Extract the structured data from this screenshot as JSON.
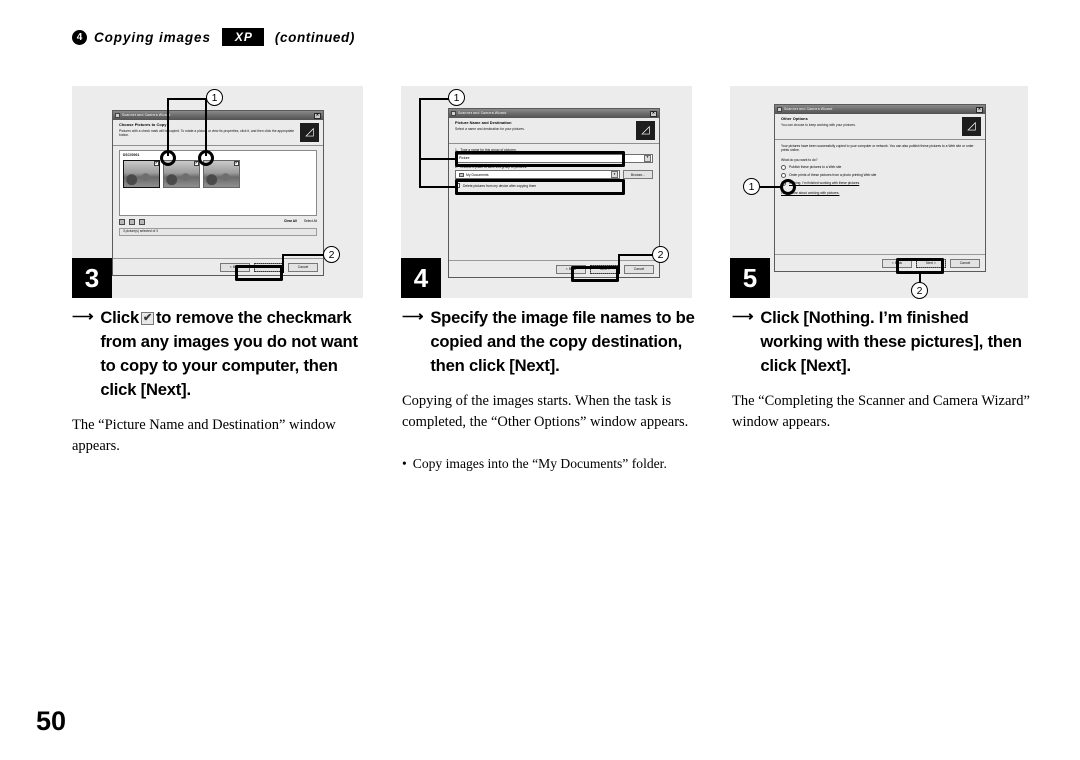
{
  "header": {
    "bullet": "4",
    "title": "Copying images",
    "badge": "XP",
    "continued": "(continued)"
  },
  "page_number": "50",
  "panels": [
    {
      "step": "3",
      "dialog": {
        "titlebar": "Scanner and Camera Wizard",
        "close_label": "✕",
        "heading": "Choose Pictures to Copy",
        "subheading": "Pictures with a check mark will be copied. To rotate a picture or view its properties, click it, and then click the appropriate button.",
        "folder_label": "DSC00001",
        "thumbs": [
          {
            "checked": "✔",
            "selected": true
          },
          {
            "checked": "✔",
            "selected": false
          },
          {
            "checked": "✔",
            "selected": false
          }
        ],
        "toolbar_icons": [
          "rotate-left-icon",
          "rotate-right-icon",
          "properties-icon"
        ],
        "counts": [
          {
            "label": "Clear All",
            "value": ""
          },
          {
            "label": "Select All",
            "value": ""
          }
        ],
        "status": "3 picture(s) selected of 3",
        "buttons": [
          {
            "label": "< Back",
            "highlighted": false
          },
          {
            "label": "Next >",
            "highlighted": true
          },
          {
            "label": "Cancel",
            "highlighted": false
          }
        ]
      },
      "callouts": [
        "1",
        "2"
      ]
    },
    {
      "step": "4",
      "dialog": {
        "titlebar": "Scanner and Camera Wizard",
        "close_label": "✕",
        "heading": "Picture Name and Destination",
        "subheading": "Select a name and destination for your pictures.",
        "fields": [
          {
            "num": "1.",
            "label": "Type a name for this group of pictures:",
            "value": "Picture",
            "arrow": "▼"
          },
          {
            "num": "2.",
            "label": "Choose a place to save this group of pictures:",
            "value": "My Documents",
            "arrow": "▼",
            "browse_label": "Browse..."
          }
        ],
        "checkbox_label": "Delete pictures from my device after copying them",
        "buttons": [
          {
            "label": "< Back",
            "highlighted": false
          },
          {
            "label": "Next >",
            "highlighted": true
          },
          {
            "label": "Cancel",
            "highlighted": false
          }
        ]
      },
      "callouts": [
        "1",
        "2"
      ]
    },
    {
      "step": "5",
      "dialog": {
        "titlebar": "Scanner and Camera Wizard",
        "close_label": "✕",
        "heading": "Other Options",
        "subheading": "You can choose to keep working with your pictures.",
        "paragraph": "Your pictures have been successfully copied to your computer or network. You can also publish these pictures to a Web site or order prints online.",
        "question": "What do you want to do?",
        "options": [
          {
            "label": "Publish these pictures to a Web site",
            "selected": false
          },
          {
            "label": "Order prints of these pictures from a photo printing Web site",
            "selected": false
          },
          {
            "label": "Nothing. I'm finished working with these pictures",
            "selected": true
          }
        ],
        "learn_more": "Learn more about working with pictures.",
        "buttons": [
          {
            "label": "< Back",
            "highlighted": false
          },
          {
            "label": "Next >",
            "highlighted": true
          },
          {
            "label": "Cancel",
            "highlighted": false
          }
        ]
      },
      "callouts": [
        "1",
        "2"
      ]
    }
  ],
  "captions": [
    {
      "bold_pre": "Click",
      "has_checkbox": true,
      "bold_post": "to remove the checkmark from any images you do not want to copy to your computer, then click [Next].",
      "body": "The “Picture Name and Destination” window appears.",
      "bullet": ""
    },
    {
      "bold_pre": "",
      "has_checkbox": false,
      "bold_post": "Specify the image file names to be copied and the copy destination, then click [Next].",
      "body": "Copying of the images starts. When the task is completed, the “Other Options” window appears.",
      "bullet": "Copy images into the “My Documents” folder."
    },
    {
      "bold_pre": "",
      "has_checkbox": false,
      "bold_post": "Click [Nothing. I’m finished working with these pictures], then click [Next].",
      "body": "The “Completing the Scanner and Camera Wizard” window appears.",
      "bullet": ""
    }
  ]
}
